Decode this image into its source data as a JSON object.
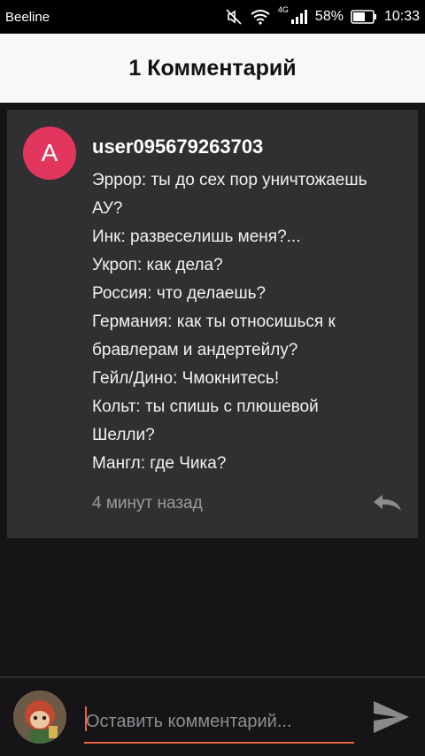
{
  "status_bar": {
    "carrier": "Beeline",
    "network_type": "4G",
    "battery": "58%",
    "time": "10:33",
    "icons": [
      "mute-icon",
      "wifi-icon",
      "signal-icon",
      "battery-icon"
    ]
  },
  "header": {
    "title": "1 Комментарий"
  },
  "comment": {
    "avatar_letter": "A",
    "avatar_color": "#e3365f",
    "username": "user095679263703",
    "text": "Эррор: ты до сех пор уничтожаешь\nАУ?\nИнк: развеселишь меня?...\nУкроп: как дела?\nРоссия: что делаешь?\nГермания: как ты относишься к\nбравлерам и андертейлу?\nГейл/Дино: Чмокнитесь!\nКольт: ты спишь с плюшевой\nШелли?\nМангл: где Чика?",
    "timestamp": "4 минут назад"
  },
  "composer": {
    "placeholder": "Оставить комментарий...",
    "value": "",
    "accent_color": "#e8643b"
  }
}
